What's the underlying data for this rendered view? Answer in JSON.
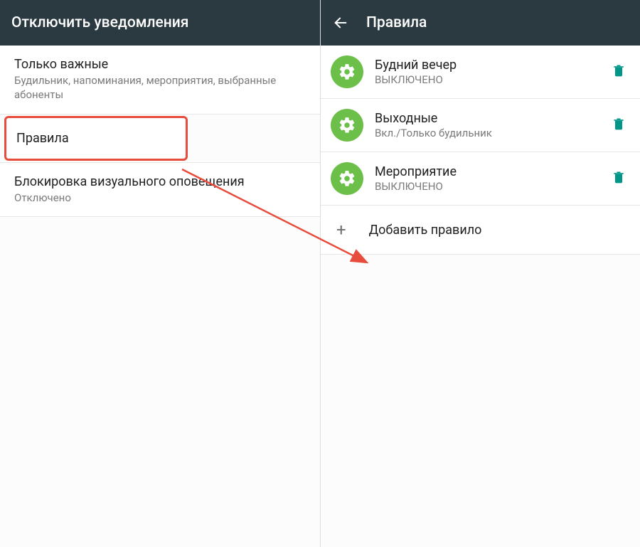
{
  "leftScreen": {
    "title": "Отключить уведомления",
    "items": [
      {
        "title": "Только важные",
        "sub": "Будильник, напоминания, мероприятия, выбранные абоненты"
      },
      {
        "title": "Правила"
      },
      {
        "title": "Блокировка визуального оповещения",
        "sub": "Отключено"
      }
    ]
  },
  "rightScreen": {
    "title": "Правила",
    "rules": [
      {
        "title": "Будний вечер",
        "sub": "ВЫКЛЮЧЕНО"
      },
      {
        "title": "Выходные",
        "sub": "Вкл./Только будильник"
      },
      {
        "title": "Мероприятие",
        "sub": "ВЫКЛЮЧЕНО"
      }
    ],
    "addLabel": "Добавить правило"
  }
}
